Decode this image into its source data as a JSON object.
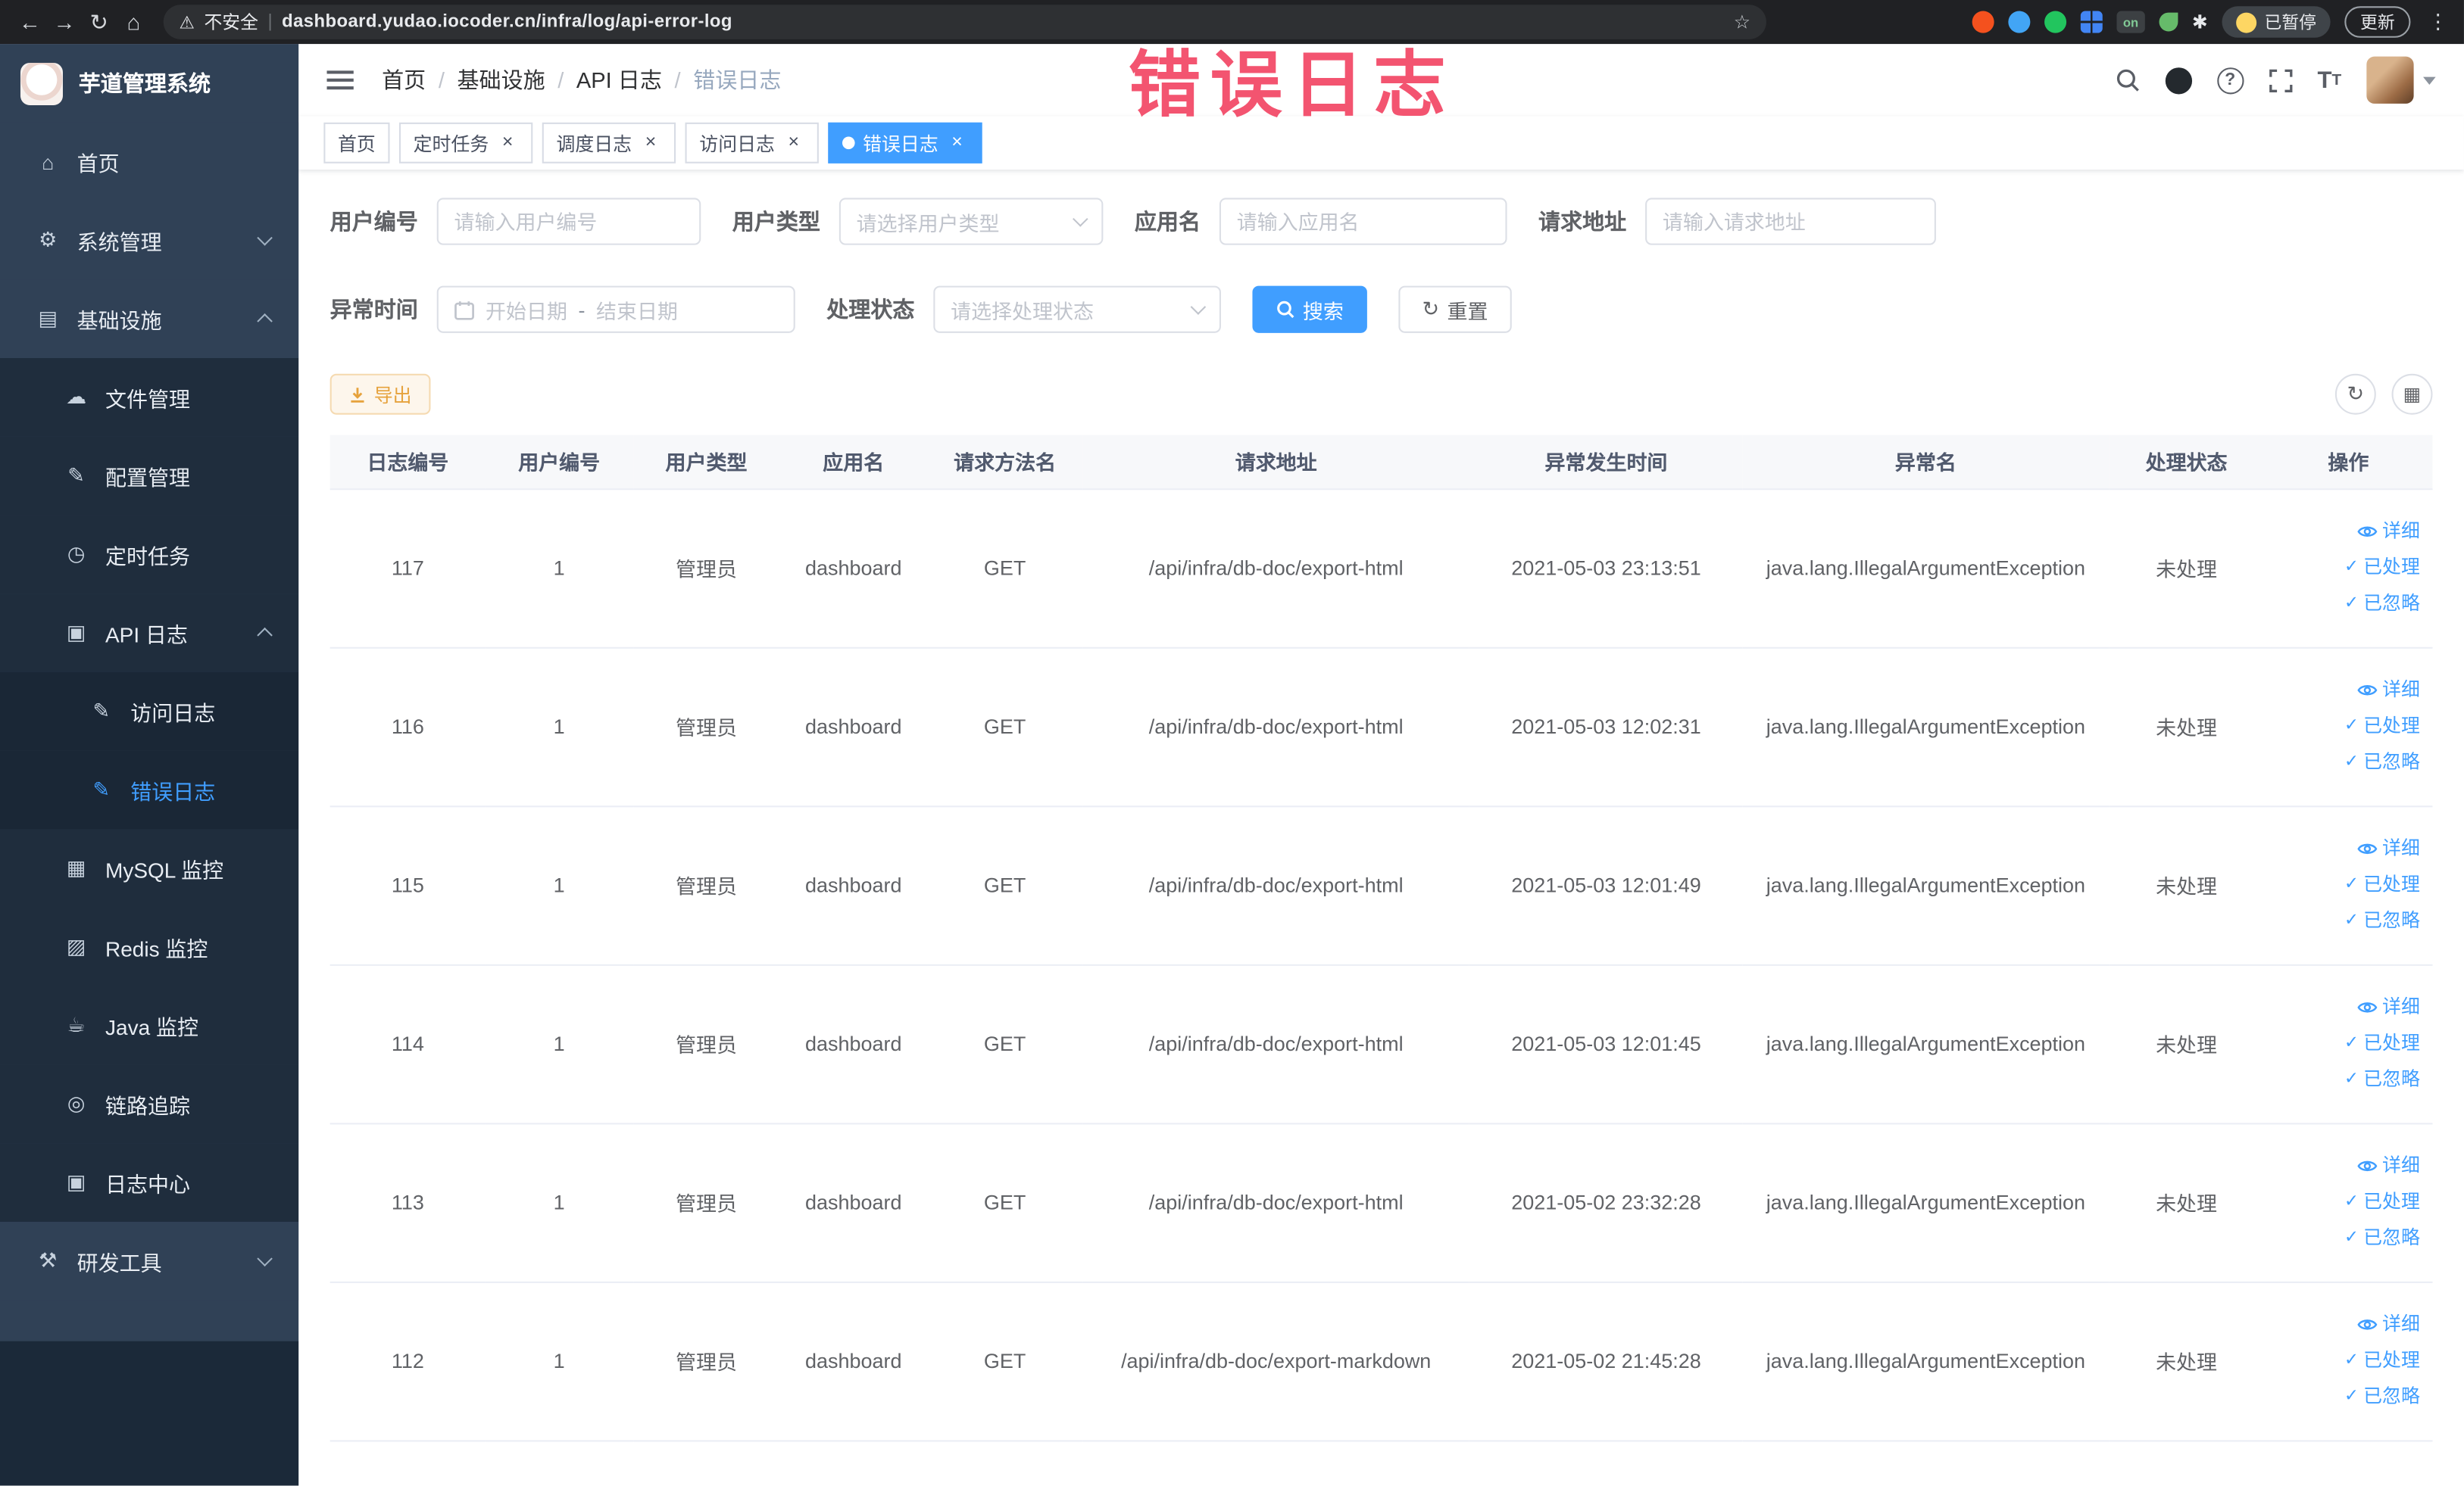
{
  "theme": {
    "accent": "#409eff",
    "warning": "#e6a23c",
    "sidebar_bg": "#304156",
    "annotation_color": "#f23d5d",
    "active_tag_bg": "#409eff"
  },
  "browser": {
    "security_label": "不安全",
    "url": "dashboard.yudao.iocoder.cn/infra/log/api-error-log",
    "paused_chip": "已暂停",
    "update_chip": "更新",
    "on_badge": "on"
  },
  "annotation": {
    "text": "错误日志"
  },
  "sidebar": {
    "title": "芋道管理系统",
    "menu": [
      {
        "label": "首页",
        "icon": "home-icon",
        "glyph": "⌂",
        "level": 1
      },
      {
        "label": "系统管理",
        "icon": "gear-icon",
        "glyph": "⚙",
        "level": 1,
        "arrow": "down"
      },
      {
        "label": "基础设施",
        "icon": "infrastructure-icon",
        "glyph": "▤",
        "level": 1,
        "arrow": "up"
      },
      {
        "label": "文件管理",
        "icon": "file-manage-icon",
        "glyph": "☁",
        "level": 2
      },
      {
        "label": "配置管理",
        "icon": "config-manage-icon",
        "glyph": "✎",
        "level": 2
      },
      {
        "label": "定时任务",
        "icon": "scheduled-task-icon",
        "glyph": "◷",
        "level": 2
      },
      {
        "label": "API 日志",
        "icon": "api-log-icon",
        "glyph": "▣",
        "level": 2,
        "arrow": "up"
      },
      {
        "label": "访问日志",
        "icon": "access-log-icon",
        "glyph": "✎",
        "level": 3
      },
      {
        "label": "错误日志",
        "icon": "error-log-icon",
        "glyph": "✎",
        "level": 3,
        "active": true
      },
      {
        "label": "MySQL 监控",
        "icon": "mysql-monitor-icon",
        "glyph": "▦",
        "level": 2
      },
      {
        "label": "Redis 监控",
        "icon": "redis-monitor-icon",
        "glyph": "▨",
        "level": 2
      },
      {
        "label": "Java 监控",
        "icon": "java-monitor-icon",
        "glyph": "☕",
        "level": 2
      },
      {
        "label": "链路追踪",
        "icon": "trace-icon",
        "glyph": "◎",
        "level": 2
      },
      {
        "label": "日志中心",
        "icon": "log-center-icon",
        "glyph": "▣",
        "level": 2
      },
      {
        "label": "研发工具",
        "icon": "dev-tools-icon",
        "glyph": "⚒",
        "level": 1,
        "arrow": "down"
      }
    ]
  },
  "navbar": {
    "breadcrumb": [
      "首页",
      "基础设施",
      "API 日志",
      "错误日志"
    ]
  },
  "tags": [
    {
      "label": "首页",
      "closable": false,
      "active": false
    },
    {
      "label": "定时任务",
      "closable": true,
      "active": false
    },
    {
      "label": "调度日志",
      "closable": true,
      "active": false
    },
    {
      "label": "访问日志",
      "closable": true,
      "active": false
    },
    {
      "label": "错误日志",
      "closable": true,
      "active": true
    }
  ],
  "filters": {
    "user_id": {
      "label": "用户编号",
      "placeholder": "请输入用户编号"
    },
    "user_type": {
      "label": "用户类型",
      "placeholder": "请选择用户类型"
    },
    "app_name": {
      "label": "应用名",
      "placeholder": "请输入应用名"
    },
    "request_url": {
      "label": "请求地址",
      "placeholder": "请输入请求地址"
    },
    "exception_time": {
      "label": "异常时间",
      "start_placeholder": "开始日期",
      "separator": "-",
      "end_placeholder": "结束日期"
    },
    "process_status": {
      "label": "处理状态",
      "placeholder": "请选择处理状态"
    },
    "search_button": "搜索",
    "reset_button": "重置"
  },
  "toolbar": {
    "export_button": "导出"
  },
  "table": {
    "columns": [
      "日志编号",
      "用户编号",
      "用户类型",
      "应用名",
      "请求方法名",
      "请求地址",
      "异常发生时间",
      "异常名",
      "处理状态",
      "操作"
    ],
    "actions": {
      "detail": "详细",
      "processed": "已处理",
      "ignored": "已忽略"
    },
    "rows": [
      {
        "id": "117",
        "user_id": "1",
        "user_type": "管理员",
        "app": "dashboard",
        "method": "GET",
        "url": "/api/infra/db-doc/export-html",
        "time": "2021-05-03 23:13:51",
        "exception": "java.lang.IllegalArgumentException",
        "status": "未处理"
      },
      {
        "id": "116",
        "user_id": "1",
        "user_type": "管理员",
        "app": "dashboard",
        "method": "GET",
        "url": "/api/infra/db-doc/export-html",
        "time": "2021-05-03 12:02:31",
        "exception": "java.lang.IllegalArgumentException",
        "status": "未处理"
      },
      {
        "id": "115",
        "user_id": "1",
        "user_type": "管理员",
        "app": "dashboard",
        "method": "GET",
        "url": "/api/infra/db-doc/export-html",
        "time": "2021-05-03 12:01:49",
        "exception": "java.lang.IllegalArgumentException",
        "status": "未处理"
      },
      {
        "id": "114",
        "user_id": "1",
        "user_type": "管理员",
        "app": "dashboard",
        "method": "GET",
        "url": "/api/infra/db-doc/export-html",
        "time": "2021-05-03 12:01:45",
        "exception": "java.lang.IllegalArgumentException",
        "status": "未处理"
      },
      {
        "id": "113",
        "user_id": "1",
        "user_type": "管理员",
        "app": "dashboard",
        "method": "GET",
        "url": "/api/infra/db-doc/export-html",
        "time": "2021-05-02 23:32:28",
        "exception": "java.lang.IllegalArgumentException",
        "status": "未处理"
      },
      {
        "id": "112",
        "user_id": "1",
        "user_type": "管理员",
        "app": "dashboard",
        "method": "GET",
        "url": "/api/infra/db-doc/export-markdown",
        "time": "2021-05-02 21:45:28",
        "exception": "java.lang.IllegalArgumentException",
        "status": "未处理"
      }
    ]
  }
}
